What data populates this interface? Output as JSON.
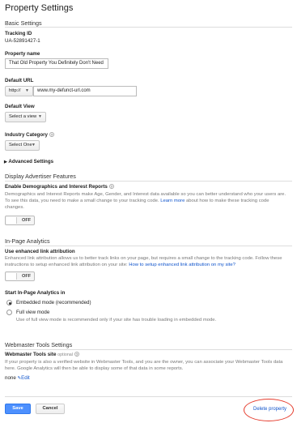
{
  "page_title": "Property Settings",
  "basic": {
    "heading": "Basic Settings",
    "tracking_id_label": "Tracking ID",
    "tracking_id_value": "UA-52891427-1",
    "property_name_label": "Property name",
    "property_name_value": "That Old Property You Definitely Don't Need",
    "default_url_label": "Default URL",
    "protocol_value": "http://",
    "url_value": "www.my-defunct-url.com",
    "default_view_label": "Default View",
    "default_view_value": "Select a view",
    "industry_label": "Industry Category",
    "industry_value": "Select One",
    "advanced_label": "Advanced Settings"
  },
  "advertiser": {
    "heading": "Display Advertiser Features",
    "enable_label": "Enable Demographics and Interest Reports",
    "desc_part1": "Demographics and Interest Reports make Age, Gender, and Interest data available so you can better understand who your users are. To see this data, you need to make a small change to your tracking code. ",
    "learn_more": "Learn more",
    "desc_part2": " about how to make these tracking code changes.",
    "toggle_text": "OFF"
  },
  "inpage": {
    "heading": "In-Page Analytics",
    "enhanced_label": "Use enhanced link attribution",
    "enhanced_desc": "Enhanced link attribution allows us to better track links on your page, but requires a small change to the tracking code. Follow these instructions to setup enhanced link attribution on your site: ",
    "enhanced_link": "How to setup enhanced link attribution on my site?",
    "toggle_text": "OFF",
    "start_label": "Start In-Page Analytics in",
    "radio_embedded": "Embedded mode (recommended)",
    "radio_full": "Full view mode",
    "full_desc": "Use of full view mode is recommended only if your site has trouble loading in embedded mode."
  },
  "webmaster": {
    "heading": "Webmaster Tools Settings",
    "site_label": "Webmaster Tools site",
    "optional": "optional",
    "desc": "If your property is also a verified website in Webmaster Tools, and you are the owner, you can associate your Webmaster Tools data here. Google Analytics will then be able to display some of that data in some reports.",
    "value": "none",
    "edit": "Edit"
  },
  "actions": {
    "save": "Save",
    "cancel": "Cancel",
    "delete": "Delete property"
  },
  "colors": {
    "primary_button": "#4d90fe",
    "link": "#1155cc",
    "highlight_ellipse": "#e53b2c"
  }
}
